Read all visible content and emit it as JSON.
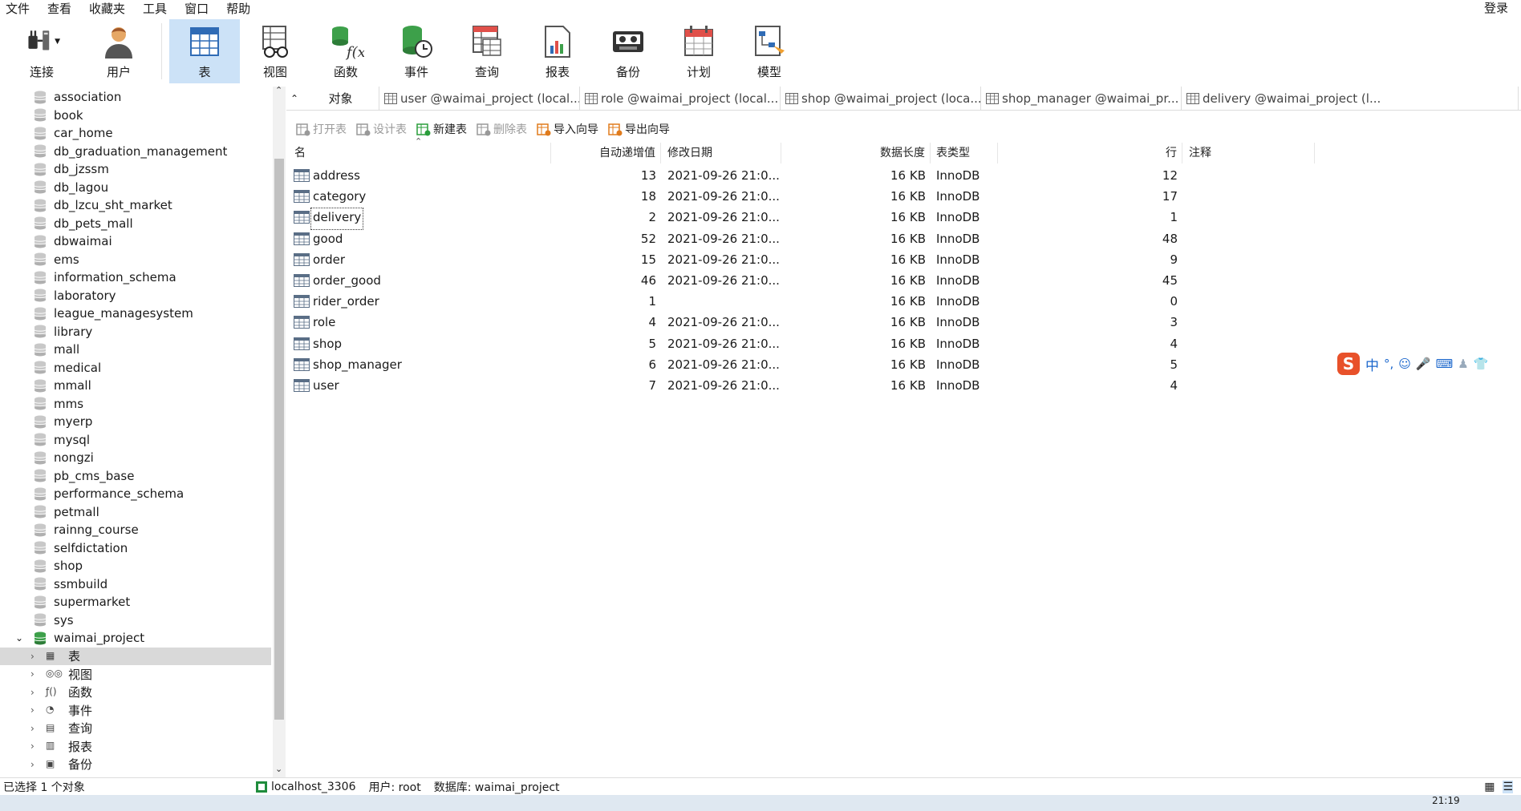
{
  "menu": [
    "文件",
    "查看",
    "收藏夹",
    "工具",
    "窗口",
    "帮助"
  ],
  "login": "登录",
  "toolbar": [
    {
      "label": "连接",
      "icon": "connect-icon"
    },
    {
      "label": "用户",
      "icon": "user-icon"
    },
    {
      "label": "表",
      "icon": "table-icon",
      "active": true
    },
    {
      "label": "视图",
      "icon": "view-icon"
    },
    {
      "label": "函数",
      "icon": "function-icon"
    },
    {
      "label": "事件",
      "icon": "event-icon"
    },
    {
      "label": "查询",
      "icon": "query-icon"
    },
    {
      "label": "报表",
      "icon": "report-icon"
    },
    {
      "label": "备份",
      "icon": "backup-icon"
    },
    {
      "label": "计划",
      "icon": "schedule-icon"
    },
    {
      "label": "模型",
      "icon": "model-icon"
    }
  ],
  "databases": [
    "association",
    "book",
    "car_home",
    "db_graduation_management",
    "db_jzssm",
    "db_lagou",
    "db_lzcu_sht_market",
    "db_pets_mall",
    "dbwaimai",
    "ems",
    "information_schema",
    "laboratory",
    "league_managesystem",
    "library",
    "mall",
    "medical",
    "mmall",
    "mms",
    "myerp",
    "mysql",
    "nongzi",
    "pb_cms_base",
    "performance_schema",
    "petmall",
    "rainng_course",
    "selfdictation",
    "shop",
    "ssmbuild",
    "supermarket",
    "sys"
  ],
  "open_db": "waimai_project",
  "db_children": [
    "表",
    "视图",
    "函数",
    "事件",
    "查询",
    "报表",
    "备份"
  ],
  "tabs": [
    "对象",
    "user @waimai_project (local...",
    "role @waimai_project (local...",
    "shop @waimai_project (loca...",
    "shop_manager @waimai_pr...",
    "delivery @waimai_project (l..."
  ],
  "actions": [
    {
      "label": "打开表",
      "enabled": false
    },
    {
      "label": "设计表",
      "enabled": false
    },
    {
      "label": "新建表",
      "enabled": true
    },
    {
      "label": "删除表",
      "enabled": false
    },
    {
      "label": "导入向导",
      "enabled": true
    },
    {
      "label": "导出向导",
      "enabled": true
    }
  ],
  "columns": [
    "名",
    "自动递增值",
    "修改日期",
    "数据长度",
    "表类型",
    "行",
    "注释"
  ],
  "rows": [
    {
      "name": "address",
      "auto": "13",
      "date": "2021-09-26 21:0...",
      "size": "16 KB",
      "type": "InnoDB",
      "rows": "12"
    },
    {
      "name": "category",
      "auto": "18",
      "date": "2021-09-26 21:0...",
      "size": "16 KB",
      "type": "InnoDB",
      "rows": "17"
    },
    {
      "name": "delivery",
      "auto": "2",
      "date": "2021-09-26 21:0...",
      "size": "16 KB",
      "type": "InnoDB",
      "rows": "1"
    },
    {
      "name": "good",
      "auto": "52",
      "date": "2021-09-26 21:0...",
      "size": "16 KB",
      "type": "InnoDB",
      "rows": "48"
    },
    {
      "name": "order",
      "auto": "15",
      "date": "2021-09-26 21:0...",
      "size": "16 KB",
      "type": "InnoDB",
      "rows": "9"
    },
    {
      "name": "order_good",
      "auto": "46",
      "date": "2021-09-26 21:0...",
      "size": "16 KB",
      "type": "InnoDB",
      "rows": "45"
    },
    {
      "name": "rider_order",
      "auto": "1",
      "date": "",
      "size": "16 KB",
      "type": "InnoDB",
      "rows": "0"
    },
    {
      "name": "role",
      "auto": "4",
      "date": "2021-09-26 21:0...",
      "size": "16 KB",
      "type": "InnoDB",
      "rows": "3"
    },
    {
      "name": "shop",
      "auto": "5",
      "date": "2021-09-26 21:0...",
      "size": "16 KB",
      "type": "InnoDB",
      "rows": "4"
    },
    {
      "name": "shop_manager",
      "auto": "6",
      "date": "2021-09-26 21:0...",
      "size": "16 KB",
      "type": "InnoDB",
      "rows": "5"
    },
    {
      "name": "user",
      "auto": "7",
      "date": "2021-09-26 21:0...",
      "size": "16 KB",
      "type": "InnoDB",
      "rows": "4"
    }
  ],
  "status": {
    "selection": "已选择 1 个对象",
    "connection": "localhost_3306",
    "user": "用户: root",
    "database": "数据库: waimai_project"
  },
  "taskbar": {
    "time": "21:19"
  },
  "ime": {
    "lang": "中"
  }
}
